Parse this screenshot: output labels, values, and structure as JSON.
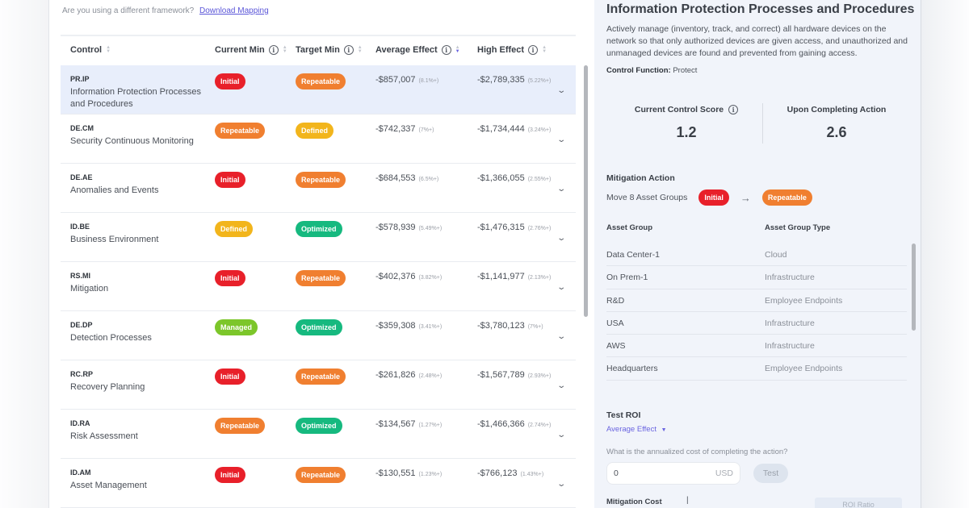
{
  "framework_note": {
    "question": "Are you using a different framework?",
    "link": "Download Mapping"
  },
  "table": {
    "columns": [
      {
        "label": "Control",
        "info": false,
        "sort": "none"
      },
      {
        "label": "Current Min",
        "info": true,
        "sort": "none"
      },
      {
        "label": "Target Min",
        "info": true,
        "sort": "none"
      },
      {
        "label": "Average Effect",
        "info": true,
        "sort": "desc"
      },
      {
        "label": "High Effect",
        "info": true,
        "sort": "none"
      }
    ],
    "rows": [
      {
        "code": "PR.IP",
        "name": "Information Protection Processes and Procedures",
        "current": "Initial",
        "target": "Repeatable",
        "avg": "-$857,007",
        "avg_pct": "(8.1%+)",
        "high": "-$2,789,335",
        "high_pct": "(5.22%+)",
        "selected": true
      },
      {
        "code": "DE.CM",
        "name": "Security Continuous Monitoring",
        "current": "Repeatable",
        "target": "Defined",
        "avg": "-$742,337",
        "avg_pct": "(7%+)",
        "high": "-$1,734,444",
        "high_pct": "(3.24%+)",
        "selected": false
      },
      {
        "code": "DE.AE",
        "name": "Anomalies and Events",
        "current": "Initial",
        "target": "Repeatable",
        "avg": "-$684,553",
        "avg_pct": "(6.5%+)",
        "high": "-$1,366,055",
        "high_pct": "(2.55%+)",
        "selected": false
      },
      {
        "code": "ID.BE",
        "name": "Business Environment",
        "current": "Defined",
        "target": "Optimized",
        "avg": "-$578,939",
        "avg_pct": "(5.49%+)",
        "high": "-$1,476,315",
        "high_pct": "(2.76%+)",
        "selected": false
      },
      {
        "code": "RS.MI",
        "name": "Mitigation",
        "current": "Initial",
        "target": "Repeatable",
        "avg": "-$402,376",
        "avg_pct": "(3.82%+)",
        "high": "-$1,141,977",
        "high_pct": "(2.13%+)",
        "selected": false
      },
      {
        "code": "DE.DP",
        "name": "Detection Processes",
        "current": "Managed",
        "target": "Optimized",
        "avg": "-$359,308",
        "avg_pct": "(3.41%+)",
        "high": "-$3,780,123",
        "high_pct": "(7%+)",
        "selected": false
      },
      {
        "code": "RC.RP",
        "name": "Recovery Planning",
        "current": "Initial",
        "target": "Repeatable",
        "avg": "-$261,826",
        "avg_pct": "(2.48%+)",
        "high": "-$1,567,789",
        "high_pct": "(2.93%+)",
        "selected": false
      },
      {
        "code": "ID.RA",
        "name": "Risk Assessment",
        "current": "Repeatable",
        "target": "Optimized",
        "avg": "-$134,567",
        "avg_pct": "(1.27%+)",
        "high": "-$1,466,366",
        "high_pct": "(2.74%+)",
        "selected": false
      },
      {
        "code": "ID.AM",
        "name": "Asset Management",
        "current": "Initial",
        "target": "Repeatable",
        "avg": "-$130,551",
        "avg_pct": "(1.23%+)",
        "high": "-$766,123",
        "high_pct": "(1.43%+)",
        "selected": false
      }
    ]
  },
  "badge_colors": {
    "Initial": "#e8202a",
    "Repeatable": "#f07f30",
    "Defined": "#f2b51c",
    "Managed": "#7cc62a",
    "Optimized": "#16b97f"
  },
  "panel": {
    "title": "Information Protection Processes and Procedures",
    "description": "Actively manage (inventory, track, and correct) all hardware devices on the network so that only authorized devices are given access, and unauthorized and unmanaged devices are found and prevented from gaining access.",
    "control_function_label": "Control Function:",
    "control_function_value": "Protect",
    "current_score_label": "Current Control Score",
    "current_score": "1.2",
    "upon_label": "Upon Completing Action",
    "upon_score": "2.6",
    "mitigation_title": "Mitigation Action",
    "mitigation_text": "Move 8 Asset Groups",
    "mitigation_from": "Initial",
    "mitigation_to": "Repeatable",
    "arrow": "→",
    "asset_group_header": "Asset Group",
    "asset_type_header": "Asset Group Type",
    "asset_groups": [
      {
        "name": "Data Center-1",
        "type": "Cloud"
      },
      {
        "name": "On Prem-1",
        "type": "Infrastructure"
      },
      {
        "name": "R&D",
        "type": "Employee Endpoints"
      },
      {
        "name": "USA",
        "type": "Infrastructure"
      },
      {
        "name": "AWS",
        "type": "Infrastructure"
      },
      {
        "name": "Headquarters",
        "type": "Employee Endpoints"
      }
    ],
    "roi_title": "Test ROI",
    "roi_effect_select": "Average Effect",
    "roi_question": "What is the annualized cost of completing the action?",
    "roi_input_value": "0",
    "roi_currency": "USD",
    "test_button": "Test",
    "mitigation_cost_label": "Mitigation Cost",
    "roi_ratio_label": "ROI Ratio"
  }
}
